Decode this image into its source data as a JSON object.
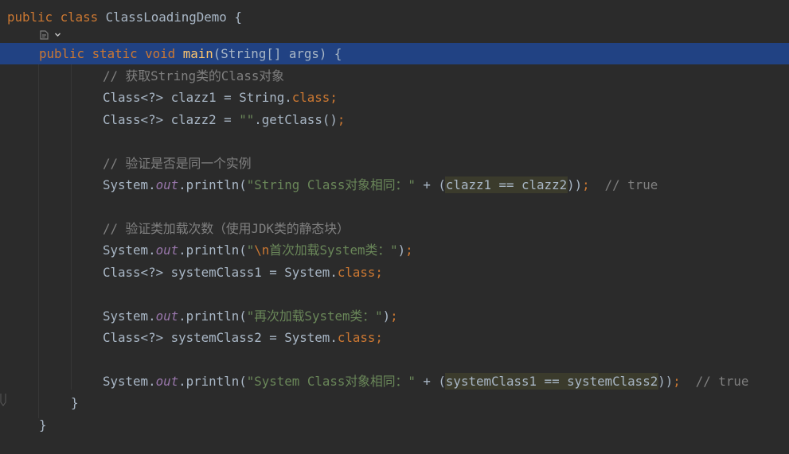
{
  "editor": {
    "lines": [
      {
        "segments": [
          {
            "t": "public class ",
            "c": "kw"
          },
          {
            "t": "ClassLoadingDemo {",
            "c": "plain"
          }
        ]
      },
      {
        "segments": []
      },
      {
        "segments": [
          {
            "t": "public static void ",
            "c": "kw"
          },
          {
            "t": "main",
            "c": "fn"
          },
          {
            "t": "(String[] args) {",
            "c": "plain"
          }
        ]
      },
      {
        "segments": [
          {
            "t": "// 获取String类的Class对象",
            "c": "cm"
          }
        ]
      },
      {
        "segments": [
          {
            "t": "Class<?> clazz1 = String.",
            "c": "plain"
          },
          {
            "t": "class",
            "c": "kw"
          },
          {
            "t": ";",
            "c": "kw"
          }
        ]
      },
      {
        "segments": [
          {
            "t": "Class<?> clazz2 = ",
            "c": "plain"
          },
          {
            "t": "\"\"",
            "c": "str"
          },
          {
            "t": ".getClass()",
            "c": "plain"
          },
          {
            "t": ";",
            "c": "kw"
          }
        ]
      },
      {
        "segments": []
      },
      {
        "segments": [
          {
            "t": "// 验证是否是同一个实例",
            "c": "cm"
          }
        ]
      },
      {
        "segments": [
          {
            "t": "System.",
            "c": "plain"
          },
          {
            "t": "out",
            "c": "field"
          },
          {
            "t": ".println(",
            "c": "plain"
          },
          {
            "t": "\"String Class对象相同：\"",
            "c": "str"
          },
          {
            "t": " + (",
            "c": "plain"
          },
          {
            "t": "clazz1 == clazz2",
            "c": "hl"
          },
          {
            "t": "))",
            "c": "plain"
          },
          {
            "t": ";",
            "c": "kw"
          },
          {
            "t": "  // true",
            "c": "cm"
          }
        ]
      },
      {
        "segments": []
      },
      {
        "segments": [
          {
            "t": "// 验证类加载次数（使用JDK类的静态块）",
            "c": "cm"
          }
        ]
      },
      {
        "segments": [
          {
            "t": "System.",
            "c": "plain"
          },
          {
            "t": "out",
            "c": "field"
          },
          {
            "t": ".println(",
            "c": "plain"
          },
          {
            "t": "\"",
            "c": "str"
          },
          {
            "t": "\\n",
            "c": "esc"
          },
          {
            "t": "首次加载System类：\"",
            "c": "str"
          },
          {
            "t": ")",
            "c": "plain"
          },
          {
            "t": ";",
            "c": "kw"
          }
        ]
      },
      {
        "segments": [
          {
            "t": "Class<?> systemClass1 = System.",
            "c": "plain"
          },
          {
            "t": "class",
            "c": "kw"
          },
          {
            "t": ";",
            "c": "kw"
          }
        ]
      },
      {
        "segments": []
      },
      {
        "segments": [
          {
            "t": "System.",
            "c": "plain"
          },
          {
            "t": "out",
            "c": "field"
          },
          {
            "t": ".println(",
            "c": "plain"
          },
          {
            "t": "\"再次加载System类：\"",
            "c": "str"
          },
          {
            "t": ")",
            "c": "plain"
          },
          {
            "t": ";",
            "c": "kw"
          }
        ]
      },
      {
        "segments": [
          {
            "t": "Class<?> systemClass2 = System.",
            "c": "plain"
          },
          {
            "t": "class",
            "c": "kw"
          },
          {
            "t": ";",
            "c": "kw"
          }
        ]
      },
      {
        "segments": []
      },
      {
        "segments": [
          {
            "t": "System.",
            "c": "plain"
          },
          {
            "t": "out",
            "c": "field"
          },
          {
            "t": ".println(",
            "c": "plain"
          },
          {
            "t": "\"System Class对象相同：\"",
            "c": "str"
          },
          {
            "t": " + (",
            "c": "plain"
          },
          {
            "t": "systemClass1 == systemClass2",
            "c": "hl"
          },
          {
            "t": "))",
            "c": "plain"
          },
          {
            "t": ";",
            "c": "kw"
          },
          {
            "t": "  // true",
            "c": "cm"
          }
        ]
      },
      {
        "segments": [
          {
            "t": "}",
            "c": "plain"
          }
        ]
      },
      {
        "segments": [
          {
            "t": "}",
            "c": "plain"
          }
        ]
      }
    ],
    "hint_icon": "ai-sparkle-icon",
    "colors": {
      "background": "#2b2b2b",
      "current_line": "#214283",
      "keyword": "#cc7832",
      "method": "#ffc66d",
      "comment": "#808080",
      "string": "#6a8759",
      "field": "#9876aa",
      "text": "#a9b7c6"
    }
  }
}
